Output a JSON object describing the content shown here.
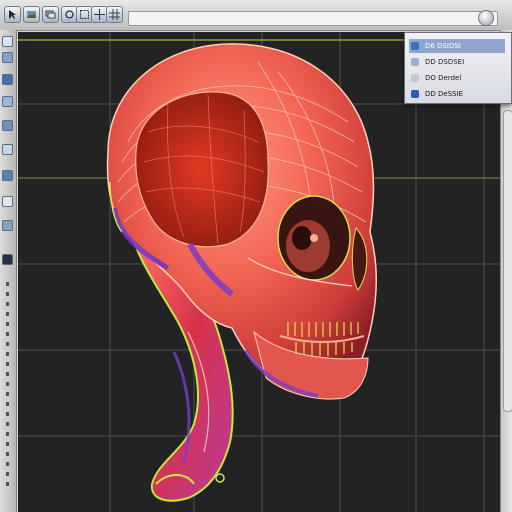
{
  "toolbar": {
    "icons": [
      "arrow-icon",
      "image-icon",
      "layers-icon",
      "rotate-icon",
      "select-icon",
      "move-icon",
      "grid-icon",
      "render-icon"
    ],
    "search_value": ""
  },
  "left_tools": {
    "icons": [
      "select-icon",
      "paint-icon",
      "shape-icon",
      "node-icon",
      "pen-icon",
      "warp-icon",
      "view-icon",
      "eye-icon",
      "axis-icon",
      "info-icon"
    ]
  },
  "panel": {
    "items": [
      {
        "label": "D6 DSIDSI",
        "icon": "folder-icon",
        "selected": true
      },
      {
        "label": "DD DSDSEI",
        "icon": "object-icon",
        "selected": false
      },
      {
        "label": "DO Derdel",
        "icon": "layer-icon",
        "selected": false
      },
      {
        "label": "DD DeSSIE",
        "icon": "shield-icon",
        "selected": false
      }
    ]
  },
  "viewport": {
    "subject": "skull-model",
    "background": "#222322",
    "grid_color": "#5a5f52",
    "accent_colors": [
      "#e85a50",
      "#f4b08e",
      "#7a3cc8",
      "#c7e83c",
      "#d63a6a"
    ]
  }
}
